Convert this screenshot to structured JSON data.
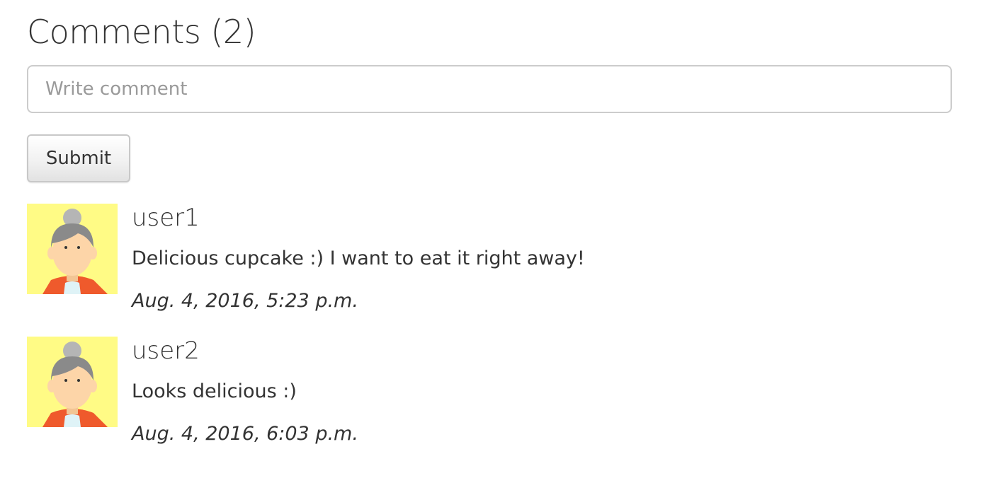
{
  "header": {
    "title": "Comments (2)"
  },
  "form": {
    "placeholder": "Write comment",
    "value": "",
    "submit_label": "Submit"
  },
  "comments": [
    {
      "author": "user1",
      "text": "Delicious cupcake :) I want to eat it right away!",
      "date": "Aug. 4, 2016, 5:23 p.m.",
      "avatar_icon": "avatar-woman-icon"
    },
    {
      "author": "user2",
      "text": "Looks delicious :)",
      "date": "Aug. 4, 2016, 6:03 p.m.",
      "avatar_icon": "avatar-woman-icon"
    }
  ],
  "colors": {
    "avatar_background": "#fffb85",
    "avatar_hair": "#8a8a8a",
    "avatar_skin": "#fdd5a8",
    "avatar_jacket": "#ef5a2c",
    "avatar_shirt": "#dff3f7",
    "text": "#333333",
    "placeholder": "#9a9a9a",
    "border": "#cccccc"
  }
}
